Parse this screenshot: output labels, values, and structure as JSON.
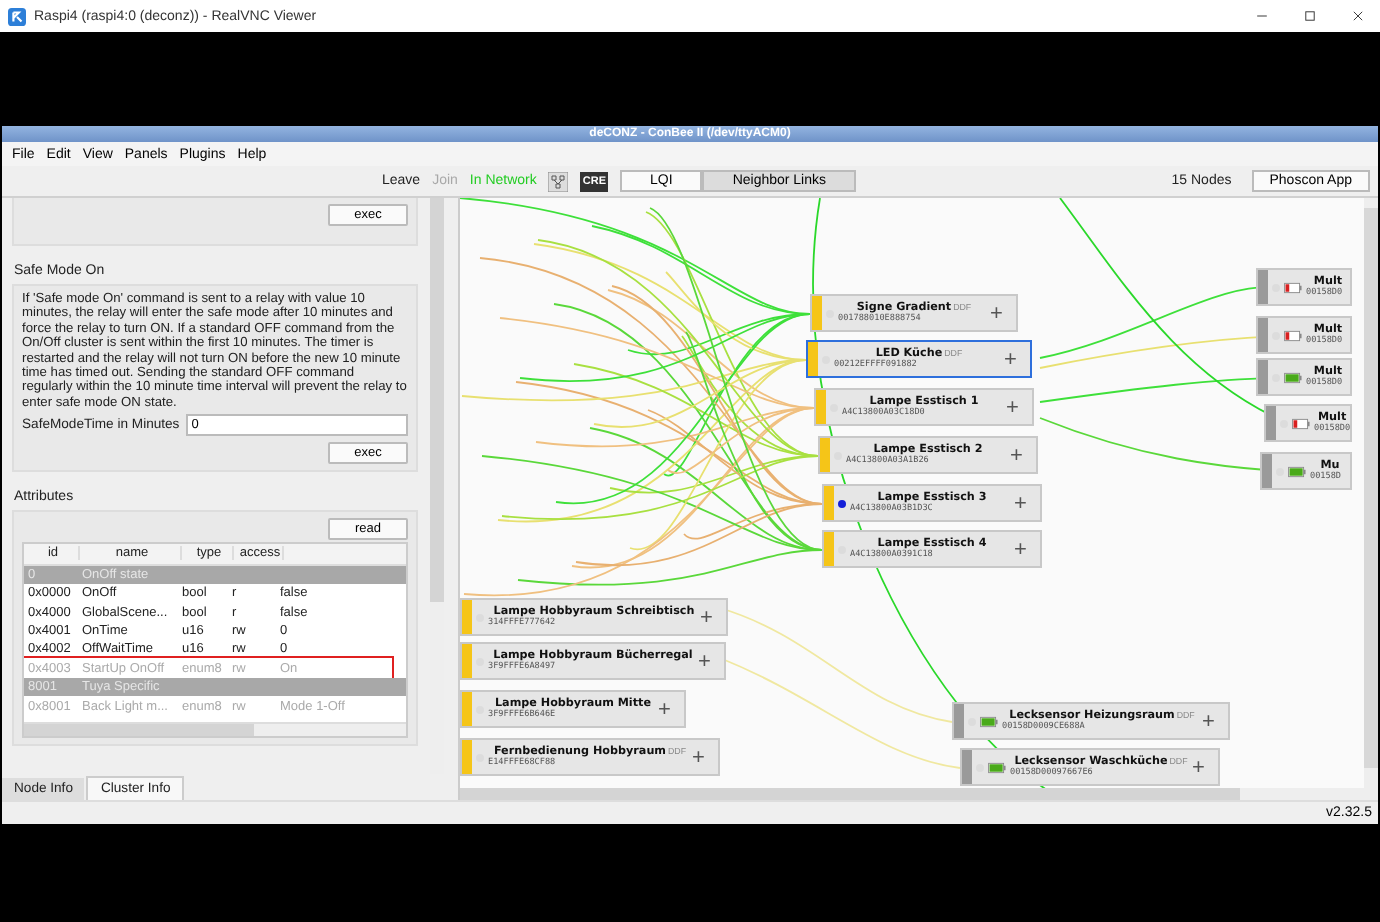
{
  "vnc_window": {
    "title": "Raspi4 (raspi4:0 (deconz)) - RealVNC Viewer"
  },
  "app_window": {
    "title": "deCONZ - ConBee II (/dev/ttyACM0)"
  },
  "menu": [
    "File",
    "Edit",
    "View",
    "Panels",
    "Plugins",
    "Help"
  ],
  "toolbar": {
    "leave": "Leave",
    "join": {
      "label": "Join",
      "disabled": true
    },
    "status": "In Network",
    "cre": "CRE",
    "view_buttons": [
      {
        "label": "LQI",
        "selected": false
      },
      {
        "label": "Neighbor Links",
        "selected": true
      }
    ],
    "node_count": "15 Nodes",
    "phoscon": "Phoscon App"
  },
  "left_panel": {
    "top_exec": "exec",
    "safe_mode": {
      "heading": "Safe Mode On",
      "description": "If 'Safe mode On' command is sent to a relay with value 10 minutes, the relay will enter the safe mode after 10 minutes and force the relay to turn ON. If a standard OFF command from the On/Off cluster is sent within the first 10 minutes. The timer is restarted and the relay will not turn ON before the new 10 minute time has timed out. Sending the standard OFF command regularly within the 10 minute time interval will prevent the relay to enter safe mode ON state.",
      "field_label": "SafeModeTime in Minutes",
      "field_value": "0",
      "exec": "exec"
    },
    "attributes": {
      "heading": "Attributes",
      "read": "read",
      "columns": [
        "id",
        "name",
        "type",
        "access"
      ],
      "rows": [
        {
          "kind": "group",
          "id": "0",
          "name": "OnOff state"
        },
        {
          "kind": "attribute",
          "id": "0x0000",
          "name": "OnOff",
          "type": "bool",
          "access": "r",
          "value": "false",
          "greyed": false,
          "highlighted": false
        },
        {
          "kind": "attribute",
          "id": "0x4000",
          "name": "GlobalScene...",
          "type": "bool",
          "access": "r",
          "value": "false",
          "greyed": false,
          "highlighted": false
        },
        {
          "kind": "attribute",
          "id": "0x4001",
          "name": "OnTime",
          "type": "u16",
          "access": "rw",
          "value": "0",
          "greyed": false,
          "highlighted": false
        },
        {
          "kind": "attribute",
          "id": "0x4002",
          "name": "OffWaitTime",
          "type": "u16",
          "access": "rw",
          "value": "0",
          "greyed": false,
          "highlighted": false
        },
        {
          "kind": "attribute",
          "id": "0x4003",
          "name": "StartUp OnOff",
          "type": "enum8",
          "access": "rw",
          "value": "On",
          "greyed": true,
          "highlighted": true
        },
        {
          "kind": "group",
          "id": "8001",
          "name": "Tuya Specific"
        },
        {
          "kind": "attribute",
          "id": "0x8001",
          "name": "Back Light m...",
          "type": "enum8",
          "access": "rw",
          "value": "Mode 1-Off",
          "greyed": true,
          "highlighted": false
        }
      ]
    }
  },
  "tabs": [
    {
      "label": "Node Info",
      "selected": false
    },
    {
      "label": "Cluster Info",
      "selected": true
    }
  ],
  "nodes": [
    {
      "kind": "light",
      "name": "Signe Gradient",
      "ddf": "DDF",
      "address": "001788010E888754",
      "add": "+",
      "selected": false,
      "indicator": false
    },
    {
      "kind": "light",
      "name": "LED Küche",
      "ddf": "DDF",
      "address": "00212EFFFF091882",
      "add": "+",
      "selected": true,
      "indicator": false
    },
    {
      "kind": "light",
      "name": "Lampe Esstisch 1",
      "address": "A4C13800A03C18D0",
      "add": "+",
      "selected": false,
      "indicator": false
    },
    {
      "kind": "light",
      "name": "Lampe Esstisch 2",
      "address": "A4C13800A03A1B26",
      "add": "+",
      "selected": false,
      "indicator": false
    },
    {
      "kind": "light",
      "name": "Lampe Esstisch 3",
      "address": "A4C13800A03B1D3C",
      "add": "+",
      "selected": false,
      "indicator": true
    },
    {
      "kind": "light",
      "name": "Lampe Esstisch 4",
      "address": "A4C13800A0391C18",
      "add": "+",
      "selected": false,
      "indicator": false
    },
    {
      "kind": "light",
      "name": "Lampe Hobbyraum Schreibtisch",
      "address": "314FFFE777642",
      "add": "+",
      "selected": false,
      "indicator": false
    },
    {
      "kind": "light",
      "name": "Lampe Hobbyraum Bücherregal",
      "address": "3F9FFFE6A8497",
      "add": "+",
      "selected": false,
      "indicator": false
    },
    {
      "kind": "light",
      "name": "Lampe Hobbyraum Mitte",
      "address": "3F9FFFE6B646E",
      "add": "+",
      "selected": false,
      "indicator": false
    },
    {
      "kind": "light",
      "name": "Fernbedienung Hobbyraum",
      "ddf": "DDF",
      "address": "E14FFFE68CF88",
      "add": "+",
      "selected": false,
      "indicator": false
    },
    {
      "kind": "sensor",
      "battery_low": false,
      "name": "Lecksensor Heizungsraum",
      "ddf": "DDF",
      "address": "00158D0009CE688A",
      "add": "+",
      "selected": false,
      "indicator": false
    },
    {
      "kind": "sensor",
      "battery_low": false,
      "name": "Lecksensor Waschküche",
      "ddf": "DDF",
      "address": "00158D00097667E6",
      "add": "+",
      "selected": false,
      "indicator": false
    },
    {
      "kind": "sensor",
      "battery_low": true,
      "name": "Mult",
      "address": "00158D0",
      "selected": false,
      "indicator": false
    },
    {
      "kind": "sensor",
      "battery_low": true,
      "name": "Mult",
      "address": "00158D0",
      "selected": false,
      "indicator": false
    },
    {
      "kind": "sensor",
      "battery_low": false,
      "name": "Mult",
      "address": "00158D0",
      "selected": false,
      "indicator": false
    },
    {
      "kind": "sensor",
      "battery_low": true,
      "name": "Mult",
      "address": "00158D0",
      "selected": false,
      "indicator": false
    },
    {
      "kind": "sensor",
      "battery_low": false,
      "name": "Mu",
      "address": "00158D",
      "selected": false,
      "indicator": false
    }
  ],
  "version": "v2.32.5"
}
